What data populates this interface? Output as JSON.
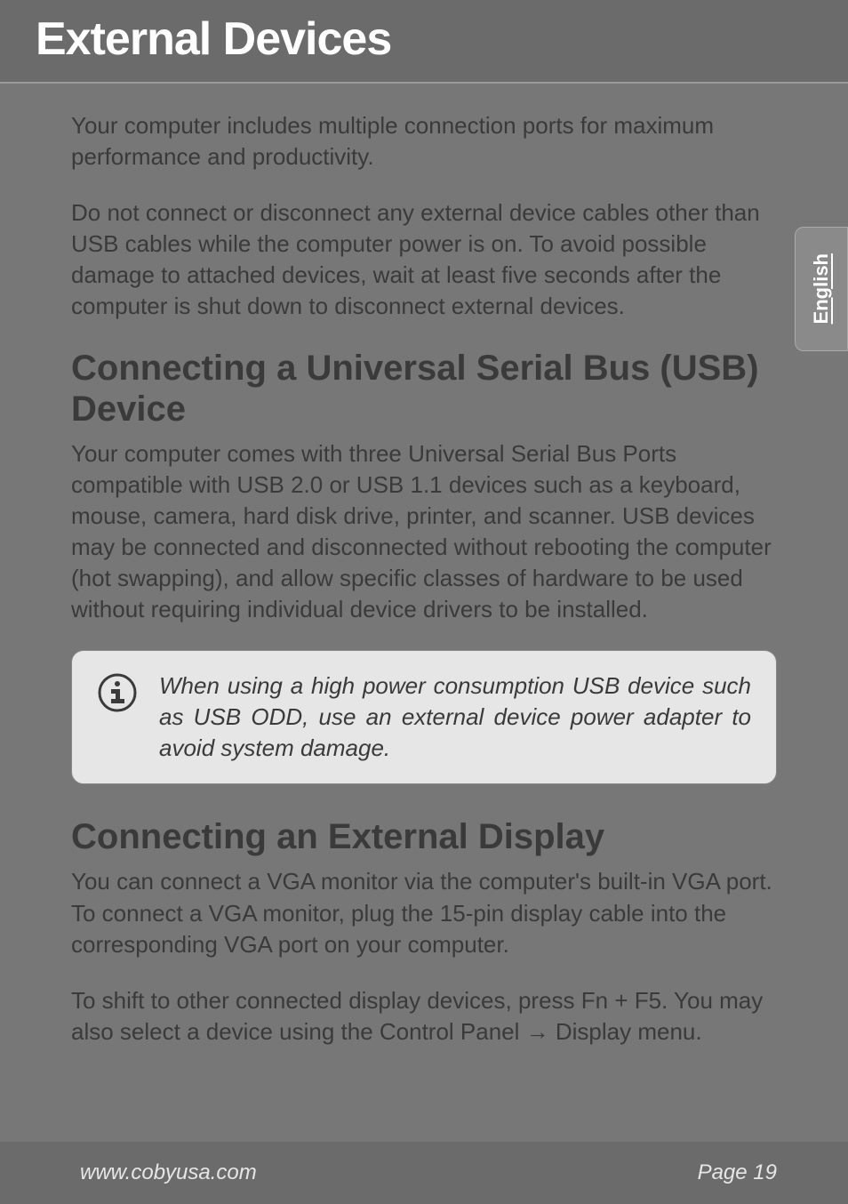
{
  "titleBar": {
    "title": "External Devices"
  },
  "langTab": {
    "label": "English"
  },
  "paragraphs": {
    "intro1": "Your computer includes multiple connection ports for maximum performance and productivity.",
    "intro2": "Do not connect or disconnect any external device cables other than USB cables while the computer power is on. To avoid possible damage to attached devices, wait at least five seconds after the computer is shut down to disconnect external devices."
  },
  "sectionUSB": {
    "heading": "Connecting a Universal Serial Bus (USB) Device",
    "body": "Your computer comes with three Universal Serial Bus Ports compatible with USB 2.0 or USB 1.1 devices such as a keyboard, mouse, camera, hard disk drive, printer, and scanner. USB devices may be connected and disconnected without rebooting the computer (hot swapping), and allow specific classes of hardware to be used without requiring individual device drivers to be installed."
  },
  "infobox": {
    "text": "When using a high power consumption USB device such as USB ODD, use an external device power adapter to avoid system damage."
  },
  "sectionDisplay": {
    "heading": "Connecting an External Display",
    "body1": "You can connect a VGA monitor via the computer's built-in VGA port. To connect a VGA monitor, plug the 15-pin display cable into the corresponding VGA port on your computer.",
    "body2_pre": "To shift to other connected display devices, press Fn + F5. You may also select a device using the Control Panel ",
    "body2_post": " Display menu."
  },
  "footer": {
    "url": "www.cobyusa.com",
    "page": "Page 19"
  }
}
